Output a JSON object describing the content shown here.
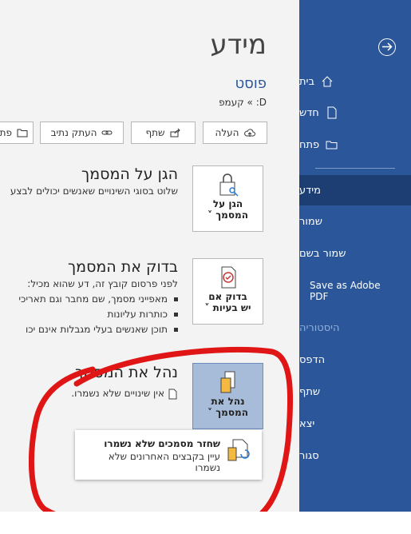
{
  "sidebar": {
    "items": [
      {
        "label": "בית",
        "icon": "home-icon"
      },
      {
        "label": "חדש",
        "icon": "new-document-icon"
      },
      {
        "label": "פתח",
        "icon": "open-folder-icon"
      },
      {
        "label": "מידע"
      },
      {
        "label": "שמור"
      },
      {
        "label": "שמור בשם"
      },
      {
        "label": "Save as Adobe PDF"
      },
      {
        "label": "היסטוריה"
      },
      {
        "label": "הדפס"
      },
      {
        "label": "שתף"
      },
      {
        "label": "יצא"
      },
      {
        "label": "סגור"
      }
    ],
    "back_icon": "back-arrow-icon",
    "bg_color": "#2b579a",
    "active_color": "#1c3e73"
  },
  "info": {
    "title": "מידע",
    "doc_name": "פוסט",
    "path": "D: » קעמפ"
  },
  "toolbar": {
    "upload": "העלה",
    "share": "שתף",
    "copy_path": "העתק נתיב",
    "open_location": "פת"
  },
  "protect": {
    "heading": "הגן על המסמך",
    "text": "שלוט בסוגי השינויים שאנשים יכולים לבצע",
    "button_line1": "הגן על",
    "button_line2": "המסמך"
  },
  "inspect": {
    "heading": "בדוק את המסמך",
    "text": "לפני פרסום קובץ זה, דע שהוא מכיל:",
    "bullets": [
      "מאפייני מסמך, שם מחבר וגם תאריכי",
      "כותרות עליונות",
      "תוכן שאנשים בעלי מגבלות אינם יכו"
    ],
    "button_line1": "בדוק אם",
    "button_line2": "יש בעיות"
  },
  "manage": {
    "heading": "נהל את המסמך",
    "text": "אין שינויים שלא נשמרו.",
    "button_line1": "נהל את",
    "button_line2": "המסמך"
  },
  "recover": {
    "title": "שחזר מסמכים שלא נשמרו",
    "desc": "עיין בקבצים האחרונים שלא נשמרו"
  }
}
